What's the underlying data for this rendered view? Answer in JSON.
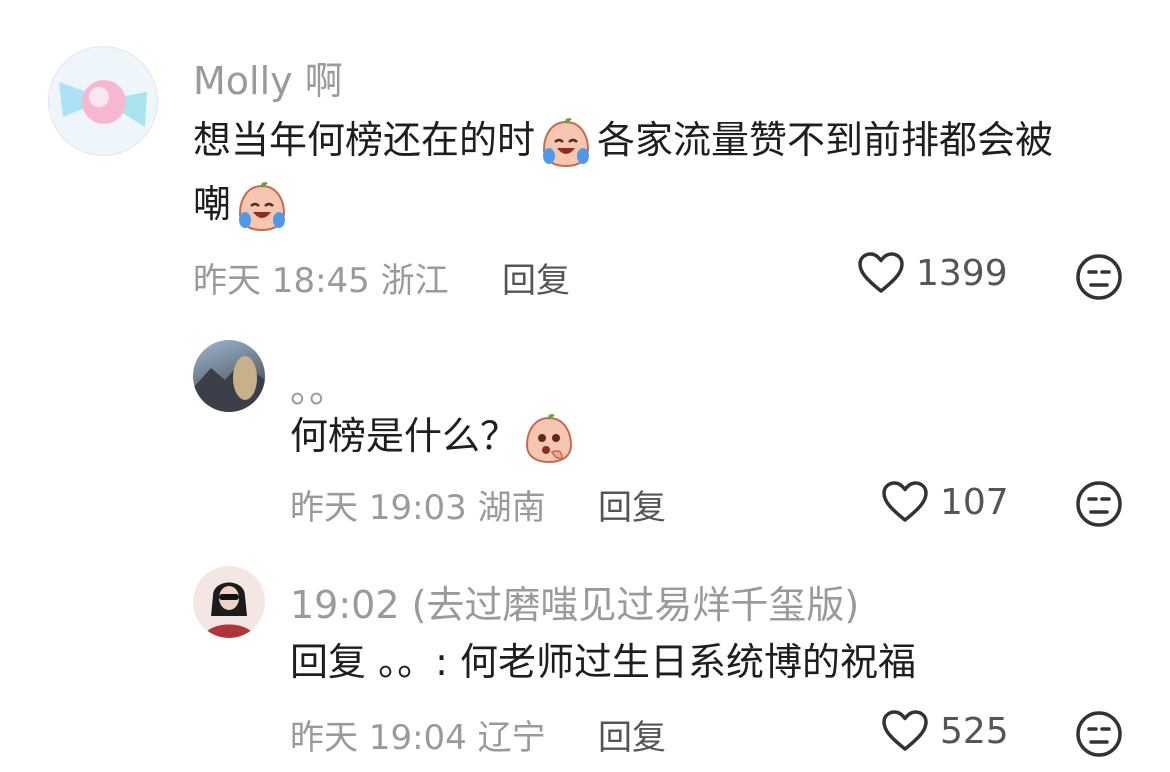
{
  "comments": [
    {
      "user": "Molly 啊",
      "text_before": "想当年何榜还在的时",
      "text_after": "各家流量赞不到前排都会被",
      "text_line2": "嘲",
      "time": "昨天 18:45 浙江",
      "reply_label": "回复",
      "likes": "1399"
    },
    {
      "user": "。。",
      "text_before": "何榜是什么？",
      "time": "昨天 19:03 湖南",
      "reply_label": "回复",
      "likes": "107"
    },
    {
      "user": "19:02 (去过磨嗤见过易烊千玺版)",
      "text_before": "回复 。。: 何老师过生日系统博的祝福",
      "time": "昨天 19:04 辽宁",
      "reply_label": "回复",
      "likes": "525"
    }
  ]
}
